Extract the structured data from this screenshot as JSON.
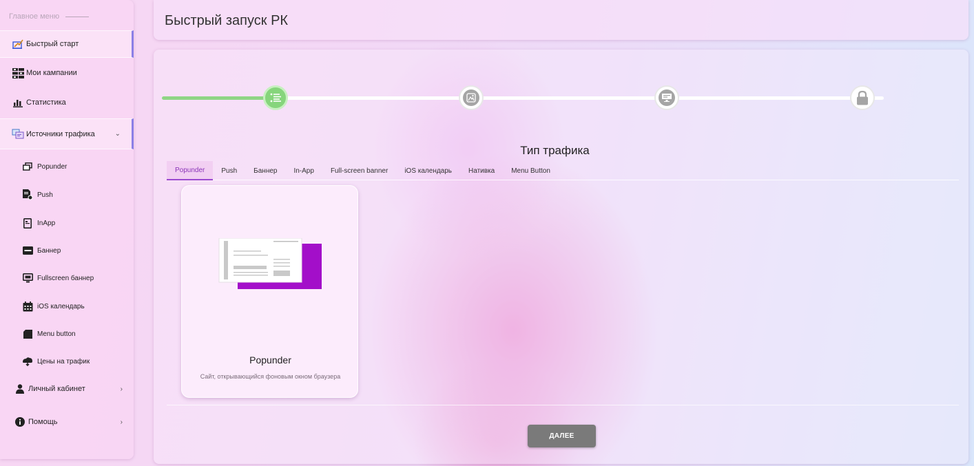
{
  "sidebar": {
    "header": "Главное меню",
    "items": [
      {
        "label": "Быстрый старт",
        "icon": "quick-start-icon"
      },
      {
        "label": "Мои кампании",
        "icon": "campaigns-icon"
      },
      {
        "label": "Статистика",
        "icon": "stats-icon"
      },
      {
        "label": "Источники трафика",
        "icon": "traffic-sources-icon"
      }
    ],
    "subitems": [
      {
        "label": "Popunder",
        "icon": "popunder-icon"
      },
      {
        "label": "Push",
        "icon": "push-icon"
      },
      {
        "label": "InApp",
        "icon": "inapp-icon"
      },
      {
        "label": "Баннер",
        "icon": "banner-icon"
      },
      {
        "label": "Fullscreen баннер",
        "icon": "fullscreen-banner-icon"
      },
      {
        "label": "iOS календарь",
        "icon": "calendar-icon"
      },
      {
        "label": "Menu button",
        "icon": "menu-button-icon"
      },
      {
        "label": "Цены на трафик",
        "icon": "traffic-prices-icon"
      }
    ],
    "bottom_items": [
      {
        "label": "Личный кабинет",
        "icon": "user-icon"
      },
      {
        "label": "Помощь",
        "icon": "info-icon"
      }
    ]
  },
  "header": {
    "title": "Быстрый запуск РК"
  },
  "stepper": {
    "progress": 0.16,
    "steps": [
      {
        "icon": "list-icon",
        "status": "completed"
      },
      {
        "icon": "creative-icon",
        "status": "pending"
      },
      {
        "icon": "targeting-icon",
        "status": "pending"
      },
      {
        "icon": "lock-icon",
        "status": "locked"
      }
    ]
  },
  "main": {
    "section_title": "Тип трафика",
    "tabs": [
      "Popunder",
      "Push",
      "Баннер",
      "In-App",
      "Full-screen banner",
      "iOS календарь",
      "Нативка",
      "Menu Button"
    ],
    "active_tab": "Popunder",
    "card": {
      "title": "Popunder",
      "description": "Сайт, открывающийся фоновым окном браузера"
    },
    "next_button": "ДАЛЕЕ"
  },
  "colors": {
    "accent_purple": "#9c4ad0",
    "step_done_green": "#86d57c",
    "button_gray": "#7a7a7a",
    "popunder_purple": "#a30fc9"
  }
}
